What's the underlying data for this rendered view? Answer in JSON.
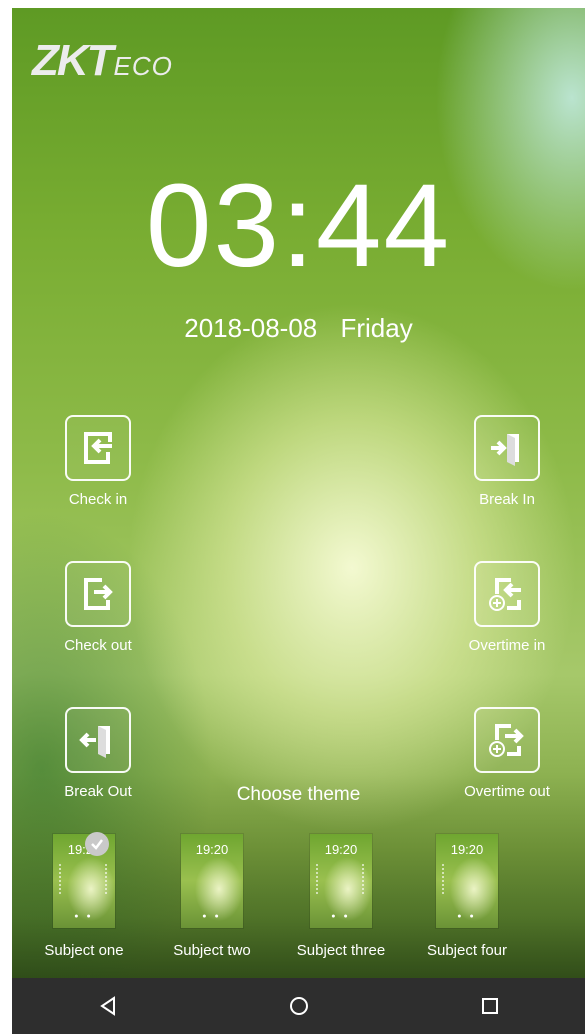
{
  "logo": {
    "main": "ZKT",
    "suffix": "ECO"
  },
  "clock": {
    "time": "03:44",
    "date": "2018-08-08",
    "weekday": "Friday"
  },
  "actions": {
    "check_in": "Check in",
    "break_in": "Break In",
    "check_out": "Check out",
    "overtime_in": "Overtime in",
    "break_out": "Break Out",
    "overtime_out": "Overtime out"
  },
  "theme": {
    "title": "Choose theme",
    "selected": "Subject one",
    "items": [
      {
        "label": "Subject one",
        "time": "19:20"
      },
      {
        "label": "Subject two",
        "time": "19:20"
      },
      {
        "label": "Subject three",
        "time": "19:20"
      },
      {
        "label": "Subject four",
        "time": "19:20"
      }
    ]
  },
  "navbar": {
    "back": "back-icon",
    "home": "home-icon",
    "recents": "recents-icon"
  }
}
